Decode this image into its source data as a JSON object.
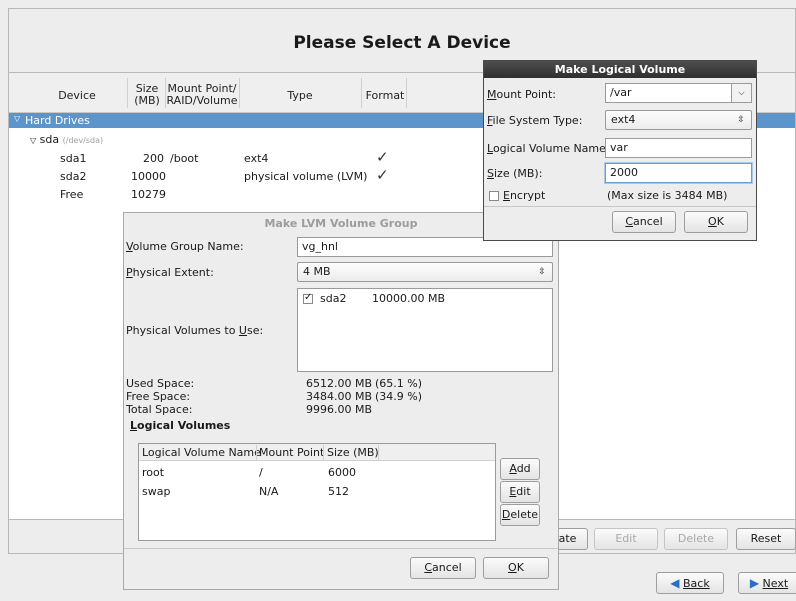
{
  "header": {
    "title": "Please Select A Device"
  },
  "table": {
    "columns": {
      "device": "Device",
      "size_1": "Size",
      "size_2": "(MB)",
      "mount_1": "Mount Point/",
      "mount_2": "RAID/Volume",
      "type": "Type",
      "format": "Format"
    },
    "group": "Hard Drives",
    "disk_name": "sda",
    "disk_path": "(/dev/sda)",
    "rows": [
      {
        "device": "sda1",
        "size": "200",
        "mount": "/boot",
        "type": "ext4",
        "format": "✓"
      },
      {
        "device": "sda2",
        "size": "10000",
        "mount": "",
        "type": "physical volume (LVM)",
        "format": "✓"
      },
      {
        "device": "Free",
        "size": "10279",
        "mount": "",
        "type": "",
        "format": ""
      }
    ]
  },
  "bottom_buttons": {
    "create": "ate",
    "edit": "Edit",
    "delete": "Delete",
    "reset": "Reset",
    "back": "Back",
    "next": "Next"
  },
  "lvm_dialog": {
    "title": "Make LVM Volume Group",
    "vg_name_label": "Volume Group Name:",
    "vg_name_value": "vg_hnl",
    "pe_label": "Physical Extent:",
    "pe_value": "4 MB",
    "pv_label": "Physical Volumes to Use:",
    "pv_items": [
      {
        "name": "sda2",
        "size": "10000.00 MB",
        "checked": true
      }
    ],
    "used_label": "Used Space:",
    "used_value": "6512.00 MB",
    "used_pct": "(65.1 %)",
    "free_label": "Free Space:",
    "free_value": "3484.00 MB",
    "free_pct": "(34.9 %)",
    "total_label": "Total Space:",
    "total_value": "9996.00 MB",
    "lv_section": "Logical Volumes",
    "lv_columns": {
      "name": "Logical Volume Name",
      "mount": "Mount Point",
      "size": "Size (MB)"
    },
    "lv_rows": [
      {
        "name": "root",
        "mount": "/",
        "size": "6000"
      },
      {
        "name": "swap",
        "mount": "N/A",
        "size": "512"
      }
    ],
    "add": "Add",
    "edit": "Edit",
    "delete": "Delete",
    "cancel": "Cancel",
    "ok": "OK"
  },
  "lv_dialog": {
    "title": "Make Logical Volume",
    "mount_label": "Mount Point:",
    "mount_value": "/var",
    "fs_label": "File System Type:",
    "fs_value": "ext4",
    "name_label": "Logical Volume Name:",
    "name_value": "var",
    "size_label": "Size (MB):",
    "size_value": "2000",
    "encrypt_label": "Encrypt",
    "max_size": "(Max size is 3484 MB)",
    "cancel": "Cancel",
    "ok": "OK"
  },
  "colors": {
    "selection": "#5c94cc",
    "title_bar": "#3a3a3a"
  }
}
